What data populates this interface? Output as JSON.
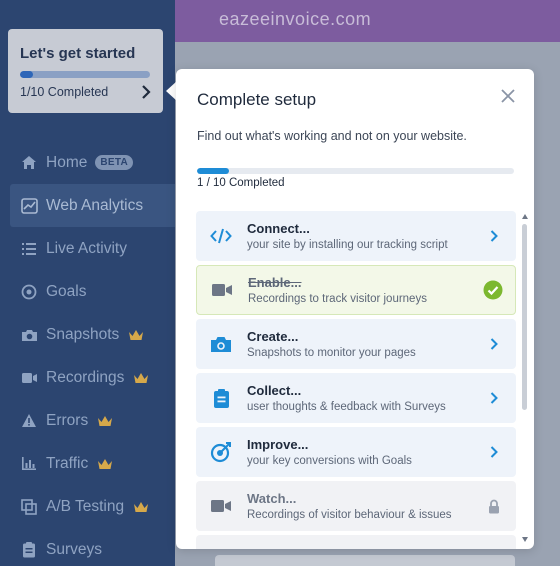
{
  "header": {
    "site": "eazeeinvoice.com"
  },
  "get_started": {
    "title": "Let's get started",
    "progress_text": "1/10 Completed",
    "progress_fraction": 0.1
  },
  "sidebar": {
    "items": [
      {
        "label": "Home",
        "icon": "home-icon",
        "badge": "BETA",
        "premium": false
      },
      {
        "label": "Web Analytics",
        "icon": "chart-icon",
        "active": true,
        "premium": false
      },
      {
        "label": "Live Activity",
        "icon": "list-icon",
        "premium": false
      },
      {
        "label": "Goals",
        "icon": "target-icon",
        "premium": false
      },
      {
        "label": "Snapshots",
        "icon": "camera-icon",
        "premium": true
      },
      {
        "label": "Recordings",
        "icon": "video-icon",
        "premium": true
      },
      {
        "label": "Errors",
        "icon": "warning-icon",
        "premium": true
      },
      {
        "label": "Traffic",
        "icon": "bar-chart-icon",
        "premium": true
      },
      {
        "label": "A/B Testing",
        "icon": "copy-icon",
        "premium": true
      },
      {
        "label": "Surveys",
        "icon": "clipboard-icon",
        "premium": false
      }
    ]
  },
  "popover": {
    "title": "Complete setup",
    "subtitle": "Find out what's working and not on your website.",
    "progress_text": "1 / 10 Completed",
    "progress_fraction": 0.1,
    "tasks": [
      {
        "title": "Connect...",
        "desc": "your site by installing our tracking script",
        "icon": "code-icon",
        "state": "todo"
      },
      {
        "title": "Enable...",
        "desc": "Recordings to track visitor journeys",
        "icon": "video-icon",
        "state": "done"
      },
      {
        "title": "Create...",
        "desc": "Snapshots to monitor your pages",
        "icon": "camera-icon",
        "state": "todo"
      },
      {
        "title": "Collect...",
        "desc": "user thoughts & feedback with Surveys",
        "icon": "clipboard-icon",
        "state": "todo"
      },
      {
        "title": "Improve...",
        "desc": "your key conversions with Goals",
        "icon": "target-icon",
        "state": "todo"
      },
      {
        "title": "Watch...",
        "desc": "Recordings of visitor behaviour & issues",
        "icon": "video-icon",
        "state": "locked"
      }
    ]
  },
  "colors": {
    "accent": "#1e8cd6",
    "sidebar_bg": "#2c4570",
    "crown": "#d6a84a",
    "check": "#7cb82f",
    "header": "#7d5c9f"
  }
}
